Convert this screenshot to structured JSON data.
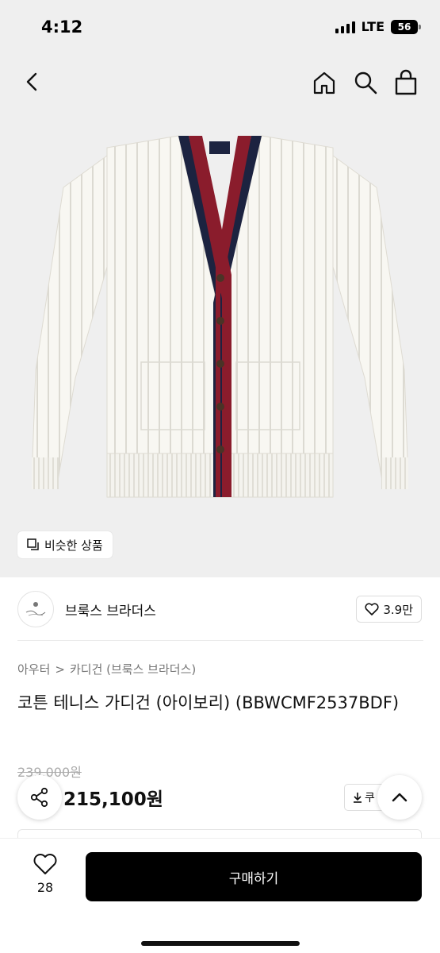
{
  "status_bar": {
    "time": "4:12",
    "network": "LTE",
    "battery": "56"
  },
  "header": {
    "back_icon": "chevron-left-icon",
    "home_icon": "home-icon",
    "search_icon": "search-icon",
    "bag_icon": "shopping-bag-icon"
  },
  "hero": {
    "image": "ivory-cable-knit-cardigan",
    "similar_label": "비슷한 상품"
  },
  "brand": {
    "name": "브룩스 브라더스",
    "likes": "3.9만"
  },
  "breadcrumb": {
    "category": "아우터",
    "separator": ">",
    "subcategory": "카디건 (브룩스 브라더스)"
  },
  "product": {
    "title": "코튼 테니스 가디건 (아이보리) (BBWCMF2537BDF)",
    "original_price": "239,000원",
    "sale_price": "215,100원",
    "coupon_label": "쿠"
  },
  "bottom_bar": {
    "wish_count": "28",
    "buy_label": "구매하기"
  },
  "colors": {
    "accent": "#000000",
    "navy": "#1c2340",
    "burgundy": "#8a1c2c",
    "ivory": "#f7f6f1"
  }
}
